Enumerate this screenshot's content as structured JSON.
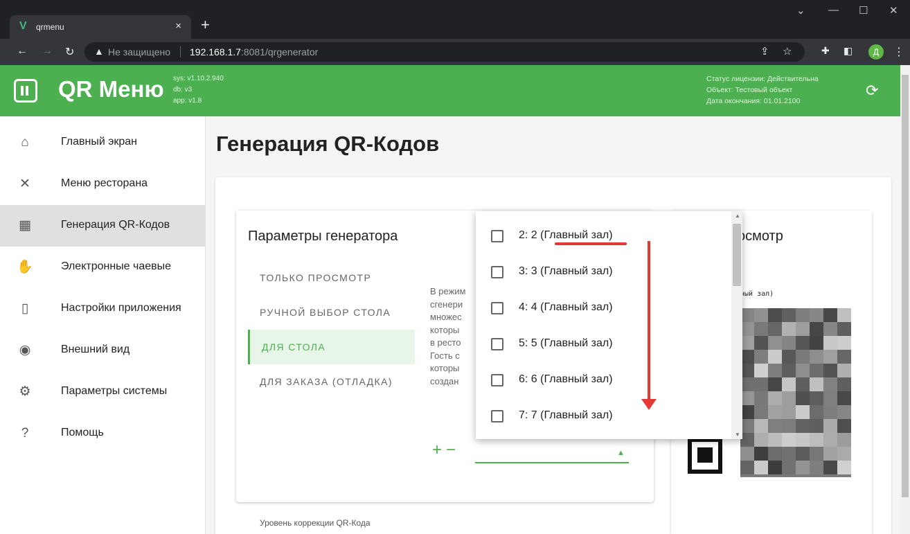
{
  "browser": {
    "tab_title": "qrmenu",
    "new_tab": "+",
    "close_tab": "×",
    "security_label": "Не защищено",
    "url_host": "192.168.1.7",
    "url_path": ":8081/qrgenerator",
    "profile_letter": "Д"
  },
  "header": {
    "brand": "QR Меню",
    "versions": [
      "sys: v1.10.2.940",
      "db: v3",
      "app: v1.8"
    ],
    "license": [
      "Статус лицензии: Действительна",
      "Объект: Тестовый объект",
      "Дата окончания: 01.01.2100"
    ]
  },
  "sidebar": {
    "items": [
      {
        "label": "Главный экран",
        "icon": "home-icon"
      },
      {
        "label": "Меню ресторана",
        "icon": "utensils-icon"
      },
      {
        "label": "Генерация QR-Кодов",
        "icon": "qr-icon"
      },
      {
        "label": "Электронные чаевые",
        "icon": "tips-icon"
      },
      {
        "label": "Настройки приложения",
        "icon": "phone-settings-icon"
      },
      {
        "label": "Внешний вид",
        "icon": "eye-icon"
      },
      {
        "label": "Параметры системы",
        "icon": "gear-icon"
      },
      {
        "label": "Помощь",
        "icon": "help-icon"
      }
    ],
    "active_index": 2
  },
  "page": {
    "title": "Генерация QR-Кодов"
  },
  "generator": {
    "title": "Параметры генератора",
    "tabs": [
      "ТОЛЬКО ПРОСМОТР",
      "РУЧНОЙ ВЫБОР СТОЛА",
      "ДЛЯ СТОЛА",
      "ДЛЯ ЗАКАЗА (ОТЛАДКА)"
    ],
    "active_tab": 2,
    "description": [
      "В режим",
      "сгенери",
      "множес",
      "которы",
      "в ресто",
      "Гость с",
      "которы",
      "создан"
    ],
    "plus": "+",
    "minus": "−"
  },
  "preview": {
    "title": "осмотр",
    "table_caption": "вный зал)"
  },
  "dropdown": {
    "options": [
      {
        "label": "2: 2 (Главный зал)",
        "checked": false
      },
      {
        "label": "3: 3 (Главный зал)",
        "checked": false
      },
      {
        "label": "4: 4 (Главный зал)",
        "checked": false
      },
      {
        "label": "5: 5 (Главный зал)",
        "checked": false
      },
      {
        "label": "6: 6 (Главный зал)",
        "checked": false
      },
      {
        "label": "7: 7 (Главный зал)",
        "checked": false
      }
    ]
  },
  "footer": {
    "ecc_label": "Уровень коррекции QR-Кода"
  },
  "colors": {
    "accent": "#4caf50",
    "annotation": "#e53935"
  }
}
